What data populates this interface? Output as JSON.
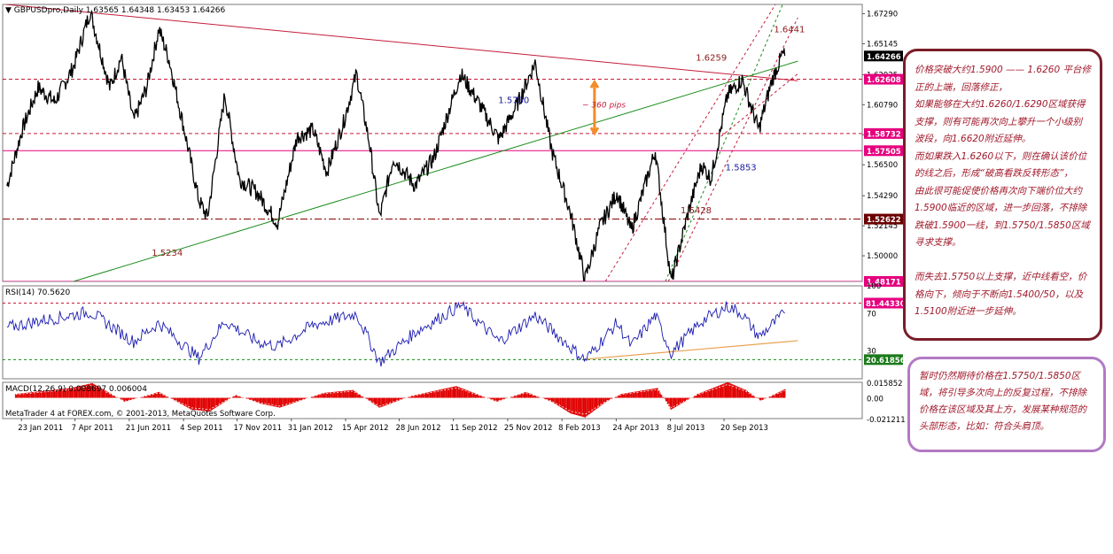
{
  "chart_data": {
    "type": "line",
    "platform": "MetaTrader 4",
    "main": {
      "header": {
        "symbol": "GBPUSDpro,Daily",
        "open": "1.63565",
        "high": "1.64348",
        "low": "1.63453",
        "close": "1.64266"
      },
      "y_range": [
        1.4817,
        1.6795
      ],
      "y_ticks": [
        "1.67290",
        "1.65145",
        "1.62925",
        "1.60790",
        "1.58645",
        "1.56500",
        "1.54290",
        "1.52145",
        "1.50000"
      ],
      "y_tick_values": [
        1.6729,
        1.65145,
        1.62925,
        1.6079,
        1.58645,
        1.565,
        1.5429,
        1.52145,
        1.5
      ],
      "price_tags": [
        {
          "label": "1.64266",
          "value": 1.64266,
          "bg": "#000000",
          "fg": "#ffffff"
        },
        {
          "label": "1.62608",
          "value": 1.62608,
          "bg": "#e6007e",
          "fg": "#ffffff"
        },
        {
          "label": "1.58732",
          "value": 1.58732,
          "bg": "#e6007e",
          "fg": "#ffffff"
        },
        {
          "label": "1.57505",
          "value": 1.57505,
          "bg": "#e6007e",
          "fg": "#ffffff"
        },
        {
          "label": "1.52622",
          "value": 1.52622,
          "bg": "#6b0000",
          "fg": "#ffffff"
        },
        {
          "label": "1.48171",
          "value": 1.48171,
          "bg": "#e6007e",
          "fg": "#ffffff"
        }
      ],
      "horizontal_lines": [
        {
          "value": 1.62608,
          "color": "#c41c3a",
          "style": "dash"
        },
        {
          "value": 1.58732,
          "color": "#c41c3a",
          "style": "dash"
        },
        {
          "value": 1.57505,
          "color": "#e6007e",
          "style": "solid"
        },
        {
          "value": 1.52622,
          "color": "#8b0000",
          "style": "dashdot"
        },
        {
          "value": 1.48171,
          "color": "#e6007e",
          "style": "solid"
        }
      ],
      "trendlines": [
        {
          "name": "resistance",
          "color": "#c41c3a",
          "from": [
            "2011-01-01",
            1.6795
          ],
          "to": [
            "2013-12-31",
            1.625
          ]
        },
        {
          "name": "support",
          "color": "#1a8c1a",
          "from": [
            "2011-04-05",
            1.4817
          ],
          "to": [
            "2013-12-31",
            1.639
          ]
        }
      ],
      "channel_lines": [
        {
          "color": "#c41c3a",
          "from": [
            "2013-04-09",
            1.4817
          ],
          "to": [
            "2013-11-30",
            1.6795
          ]
        },
        {
          "color": "#1a8c1a",
          "from": [
            "2013-07-01",
            1.4817
          ],
          "to": [
            "2013-12-10",
            1.6795
          ]
        },
        {
          "color": "#c41c3a",
          "from": [
            "2013-07-05",
            1.4817
          ],
          "to": [
            "2013-12-31",
            1.67
          ]
        },
        {
          "color": "#c41c3a",
          "from": [
            "2013-09-16",
            1.5853
          ],
          "to": [
            "2013-12-31",
            1.63
          ]
        }
      ],
      "annotations": [
        {
          "text": "1.6441",
          "date": "2013-11-28",
          "value": 1.6595,
          "color": "#8b1a1a"
        },
        {
          "text": "1.6259",
          "date": "2013-08-12",
          "value": 1.6395,
          "color": "#8b1a1a"
        },
        {
          "text": "1.5750",
          "date": "2012-11-12",
          "value": 1.609,
          "color": "#1a1aa0"
        },
        {
          "text": "~ 360 pips",
          "date": "2013-03-08",
          "value": 1.606,
          "color": "#c41c3a"
        },
        {
          "text": "1.5853",
          "date": "2013-09-22",
          "value": 1.561,
          "color": "#1a1aa0"
        },
        {
          "text": "1.5428",
          "date": "2013-07-22",
          "value": 1.5305,
          "color": "#8b1a1a"
        },
        {
          "text": "1.5234",
          "date": "2011-07-22",
          "value": 1.5,
          "color": "#8b1a1a"
        }
      ],
      "price_series": [
        [
          "2011-01-03",
          1.55
        ],
        [
          "2011-01-24",
          1.59
        ],
        [
          "2011-02-15",
          1.62
        ],
        [
          "2011-03-10",
          1.61
        ],
        [
          "2011-04-05",
          1.635
        ],
        [
          "2011-04-28",
          1.6746
        ],
        [
          "2011-05-25",
          1.62
        ],
        [
          "2011-06-10",
          1.642
        ],
        [
          "2011-06-27",
          1.596
        ],
        [
          "2011-07-15",
          1.62
        ],
        [
          "2011-08-01",
          1.662
        ],
        [
          "2011-08-15",
          1.64
        ],
        [
          "2011-09-05",
          1.59
        ],
        [
          "2011-09-25",
          1.54
        ],
        [
          "2011-10-07",
          1.5271
        ],
        [
          "2011-10-31",
          1.615
        ],
        [
          "2011-11-20",
          1.555
        ],
        [
          "2011-12-15",
          1.545
        ],
        [
          "2012-01-12",
          1.5234
        ],
        [
          "2012-02-08",
          1.585
        ],
        [
          "2012-03-01",
          1.59
        ],
        [
          "2012-03-20",
          1.56
        ],
        [
          "2012-04-12",
          1.595
        ],
        [
          "2012-04-30",
          1.63
        ],
        [
          "2012-05-18",
          1.58
        ],
        [
          "2012-06-01",
          1.5269
        ],
        [
          "2012-06-20",
          1.57
        ],
        [
          "2012-07-20",
          1.55
        ],
        [
          "2012-08-15",
          1.57
        ],
        [
          "2012-09-21",
          1.63
        ],
        [
          "2012-10-15",
          1.61
        ],
        [
          "2012-11-13",
          1.583
        ],
        [
          "2012-12-10",
          1.61
        ],
        [
          "2013-01-02",
          1.638
        ],
        [
          "2013-01-25",
          1.575
        ],
        [
          "2013-02-20",
          1.53
        ],
        [
          "2013-03-12",
          1.4832
        ],
        [
          "2013-04-01",
          1.52
        ],
        [
          "2013-04-25",
          1.545
        ],
        [
          "2013-05-15",
          1.518
        ],
        [
          "2013-06-17",
          1.575
        ],
        [
          "2013-07-09",
          1.4813
        ],
        [
          "2013-08-01",
          1.53
        ],
        [
          "2013-08-20",
          1.565
        ],
        [
          "2013-09-02",
          1.555
        ],
        [
          "2013-09-25",
          1.615
        ],
        [
          "2013-10-15",
          1.6259
        ],
        [
          "2013-11-07",
          1.59
        ],
        [
          "2013-11-25",
          1.625
        ],
        [
          "2013-12-10",
          1.6441
        ],
        [
          "2013-12-13",
          1.6427
        ]
      ]
    },
    "rsi": {
      "header": "RSI(14) 70.5620",
      "y_ticks": [
        "100",
        "70",
        "30",
        "0"
      ],
      "y_range": [
        0,
        100
      ],
      "levels": [
        {
          "value": 81.4433,
          "label": "81.44330",
          "color": "#c41c3a",
          "bg": "#e6007e"
        },
        {
          "value": 20.61856,
          "label": "20.61856",
          "color": "#1a8c1a",
          "bg": "#1a7a1a"
        }
      ],
      "trendline": {
        "color": "#e8a050",
        "from": [
          "2013-03-12",
          21
        ],
        "to": [
          "2013-12-31",
          41
        ]
      },
      "series": [
        [
          "2011-01-03",
          55
        ],
        [
          "2011-02-15",
          62
        ],
        [
          "2011-04-28",
          72
        ],
        [
          "2011-06-27",
          40
        ],
        [
          "2011-08-01",
          60
        ],
        [
          "2011-09-25",
          22
        ],
        [
          "2011-10-31",
          62
        ],
        [
          "2011-12-15",
          40
        ],
        [
          "2012-01-12",
          35
        ],
        [
          "2012-03-01",
          58
        ],
        [
          "2012-04-30",
          70
        ],
        [
          "2012-06-01",
          18
        ],
        [
          "2012-07-20",
          50
        ],
        [
          "2012-09-21",
          79
        ],
        [
          "2012-11-13",
          40
        ],
        [
          "2013-01-02",
          68
        ],
        [
          "2013-03-12",
          20
        ],
        [
          "2013-04-25",
          60
        ],
        [
          "2013-05-15",
          35
        ],
        [
          "2013-06-17",
          68
        ],
        [
          "2013-07-09",
          28
        ],
        [
          "2013-08-20",
          62
        ],
        [
          "2013-09-25",
          78
        ],
        [
          "2013-10-15",
          70
        ],
        [
          "2013-11-07",
          45
        ],
        [
          "2013-12-13",
          70.56
        ]
      ]
    },
    "macd": {
      "header": "MACD(12,26,9) 0.008697 0.006004",
      "y_ticks": [
        "0.015852",
        "0.00",
        "-0.021211"
      ],
      "y_range": [
        -0.021211,
        0.015852
      ],
      "histogram": [
        [
          "2011-01-15",
          0.004
        ],
        [
          "2011-04-01",
          0.01
        ],
        [
          "2011-05-01",
          0.015
        ],
        [
          "2011-06-15",
          -0.004
        ],
        [
          "2011-08-01",
          0.006
        ],
        [
          "2011-09-15",
          -0.012
        ],
        [
          "2011-10-10",
          -0.014
        ],
        [
          "2011-11-15",
          0.003
        ],
        [
          "2011-12-20",
          -0.006
        ],
        [
          "2012-01-15",
          -0.01
        ],
        [
          "2012-03-15",
          0.005
        ],
        [
          "2012-04-25",
          0.008
        ],
        [
          "2012-06-01",
          -0.01
        ],
        [
          "2012-07-15",
          0.002
        ],
        [
          "2012-09-15",
          0.012
        ],
        [
          "2012-11-10",
          -0.004
        ],
        [
          "2012-12-20",
          0.006
        ],
        [
          "2013-01-25",
          -0.004
        ],
        [
          "2013-02-20",
          -0.016
        ],
        [
          "2013-03-12",
          -0.02
        ],
        [
          "2013-04-10",
          -0.004
        ],
        [
          "2013-05-01",
          0.004
        ],
        [
          "2013-06-20",
          0.01
        ],
        [
          "2013-07-09",
          -0.012
        ],
        [
          "2013-08-15",
          0.004
        ],
        [
          "2013-09-25",
          0.016
        ],
        [
          "2013-10-20",
          0.008
        ],
        [
          "2013-11-10",
          -0.003
        ],
        [
          "2013-12-13",
          0.008697
        ]
      ]
    },
    "x_ticks": [
      "23 Jan 2011",
      "7 Apr 2011",
      "21 Jun 2011",
      "4 Sep 2011",
      "17 Nov 2011",
      "31 Jan 2012",
      "15 Apr 2012",
      "28 Jun 2012",
      "11 Sep 2012",
      "25 Nov 2012",
      "8 Feb 2013",
      "24 Apr 2013",
      "8 Jul 2013",
      "20 Sep 2013"
    ],
    "x_tick_dates": [
      "2011-01-23",
      "2011-04-07",
      "2011-06-21",
      "2011-09-04",
      "2011-11-17",
      "2012-01-31",
      "2012-04-15",
      "2012-06-28",
      "2012-09-11",
      "2012-11-25",
      "2013-02-08",
      "2013-04-24",
      "2013-07-08",
      "2013-09-20"
    ],
    "x_range": [
      "2010-12-28",
      "2014-03-30"
    ],
    "watermark": "MetaTrader 4 at FOREX.com, © 2001-2013, MetaQuotes Software Corp.",
    "grid": false
  },
  "notes": {
    "primary": "价格突破大约1.5900 —— 1.6260 平台修\n正的上端，回落修正，\n如果能够在大约1.6260/1.6290区域获得\n支撑，则有可能再次向上攀升一个小级别\n波段，向1.6620附近延伸。\n而如果跌入1.6260以下，则在确认该价位\n的线之后，形成“破高看跌反转形态”，\n由此很可能促使价格再次向下端价位大约\n1.5900临近的区域，进一步回落，不排除\n跌破1.5900一线，到1.5750/1.5850区域\n寻求支撑。\n\n而失去1.5750以上支撑，近中线看空，价\n格向下，倾向于不断向1.5400/50，以及\n1.5100附近进一步延伸。",
    "secondary": "暂时仍然期待价格在1.5750/1.5850区\n域，将引导多次向上的反复过程，不排除\n价格在该区域及其上方，发展某种规范的\n头部形态，比如：符合头肩顶。",
    "primary_border": "#7a1e2a",
    "secondary_border": "#b27ac4",
    "text_color": "#a0182a"
  }
}
